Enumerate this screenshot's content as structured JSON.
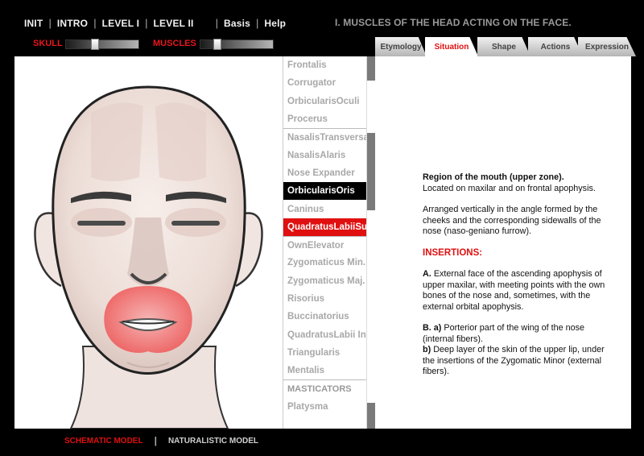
{
  "nav": {
    "items": [
      "INIT",
      "INTRO",
      "LEVEL I",
      "LEVEL II",
      "Basis",
      "Help"
    ]
  },
  "page_title": "I. MUSCLES OF THE HEAD ACTING ON THE FACE.",
  "sliders": {
    "skull_label": "SKULL",
    "skull_value": 0.38,
    "muscles_label": "MUSCLES",
    "muscles_value": 0.2
  },
  "tabs": [
    "Etymology",
    "Situation",
    "Shape",
    "Actions",
    "Expression"
  ],
  "active_tab": "Situation",
  "muscles": [
    "Frontalis",
    "Corrugator",
    "OrbicularisOculi",
    "Procerus",
    "NasalisTransversa",
    "NasalisAlaris",
    "Nose Expander",
    "OrbicularisOris",
    "Caninus",
    "QuadratusLabiiSup.",
    "OwnElevator",
    "Zygomaticus Min.",
    "Zygomaticus Maj.",
    "Risorius",
    "Buccinatorius",
    "QuadratusLabii Inf.",
    "Triangularis",
    "Mentalis",
    "MASTICATORS",
    "Platysma"
  ],
  "selected_muscle": "OrbicularisOris",
  "highlighted_muscle": "QuadratusLabiiSup.",
  "info": {
    "region_title": "Region of the mouth (upper zone).",
    "region_text": "Located on maxilar and on frontal apophysis.",
    "arranged_text": "Arranged vertically in the angle formed by the cheeks and the corresponding sidewalls of the nose (naso-geniano furrow).",
    "insertions_heading": "INSERTIONS:",
    "a_label": "A.",
    "a_text": "External face of the ascending apophysis of upper maxilar, with meeting points with the own bones of the nose and, sometimes, with the external orbital apophysis.",
    "ba_label": "B. a)",
    "ba_text": "Porterior part of the wing of the nose (internal fibers).",
    "bb_label": "b)",
    "bb_text": "Deep layer of the skin of the upper lip, under the insertions of the Zygomatic Minor (external fibers)."
  },
  "bottom": {
    "schematic": "SCHEMATIC MODEL",
    "naturalistic": "NATURALISTIC MODEL"
  },
  "colors": {
    "accent_red": "#e01010",
    "lip_highlight": "#ef6a6a"
  }
}
